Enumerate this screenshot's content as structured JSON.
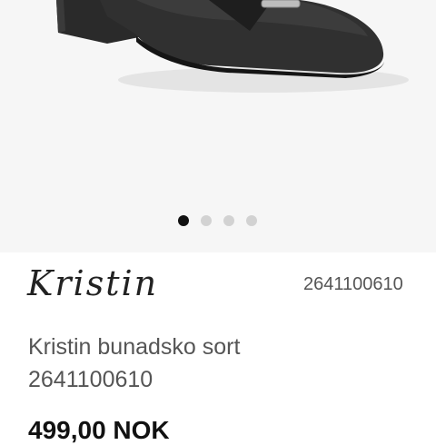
{
  "product": {
    "image_icon": "shoe-photo",
    "gallery_dots": [
      true,
      false,
      false,
      false
    ],
    "brand_logo": "Kristin",
    "sku": "2641100610",
    "title_line1": "Kristin bunadsko sort",
    "title_line2": "2641100610",
    "price": "499,00 NOK"
  },
  "colors": {
    "gallery_bg": "#f6f6f6",
    "dot_active": "#111111",
    "dot_inactive": "#d2d2d2",
    "text_muted": "#555555"
  }
}
